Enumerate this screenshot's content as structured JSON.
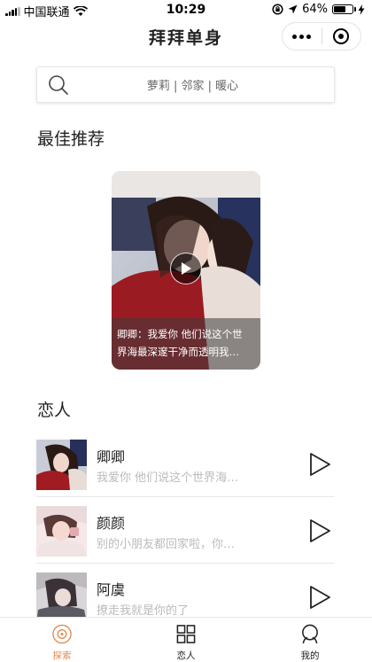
{
  "status_bar": {
    "carrier": "中国联通",
    "time": "10:29",
    "battery": "64%",
    "battery_level": 0.64
  },
  "nav": {
    "title": "拜拜单身"
  },
  "search": {
    "placeholder": "萝莉 | 邻家 | 暖心"
  },
  "featured": {
    "section_title": "最佳推荐",
    "caption_line1": "卿卿：我爱你 他们说这个世",
    "caption_line2": "界海最深邃干净而透明我…"
  },
  "lovers": {
    "section_title": "恋人",
    "items": [
      {
        "name": "卿卿",
        "subtitle": "我爱你 他们说这个世界海…"
      },
      {
        "name": "颜颜",
        "subtitle": "别的小朋友都回家啦，你…"
      },
      {
        "name": "阿虞",
        "subtitle": "撩走我就是你的了"
      }
    ]
  },
  "tabbar": {
    "tabs": [
      {
        "label": "探索",
        "icon": "compass-icon",
        "active": true
      },
      {
        "label": "恋人",
        "icon": "grid-icon",
        "active": false
      },
      {
        "label": "我的",
        "icon": "person-icon",
        "active": false
      }
    ]
  },
  "colors": {
    "accent": "#e08b52",
    "text_primary": "#222222",
    "text_secondary": "#bbbbbb"
  }
}
